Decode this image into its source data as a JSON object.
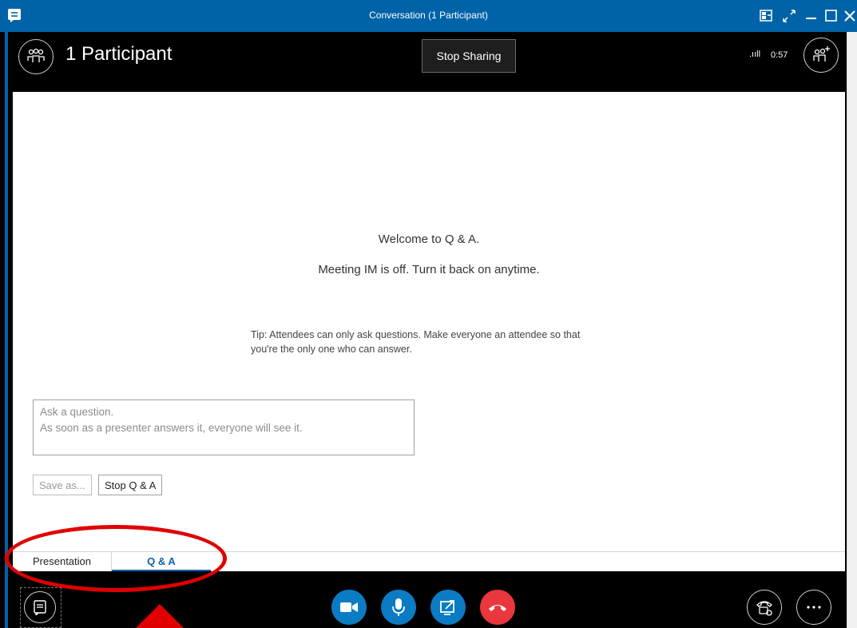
{
  "window": {
    "title": "Conversation (1 Participant)"
  },
  "header": {
    "participants_label": "1 Participant",
    "stop_sharing_label": "Stop Sharing",
    "signal_label": ".ııll",
    "timer": "0:57"
  },
  "qa": {
    "welcome": "Welcome to Q & A.",
    "im_status": "Meeting IM is off. Turn it back on anytime.",
    "tip_line1": "Tip: Attendees can only ask questions. Make everyone an attendee so that",
    "tip_line2": "you're the only one who can answer.",
    "question_placeholder_line1": "Ask a question.",
    "question_placeholder_line2": "As soon as a presenter answers it, everyone will see it.",
    "save_as_label": "Save as...",
    "stop_qa_label": "Stop Q & A"
  },
  "tabs": [
    {
      "label": "Presentation",
      "active": false
    },
    {
      "label": "Q & A",
      "active": true
    }
  ],
  "colors": {
    "title_bar": "#0063a8",
    "accent": "#0a62b0",
    "video_button": "#0b7bc4",
    "hangup_button": "#e8383d",
    "annotation": "#e00000"
  },
  "icons": {
    "app": "chat-bubble-icon",
    "participants": "people-icon",
    "add_people": "add-people-icon",
    "video": "video-camera-icon",
    "mic": "microphone-icon",
    "share": "share-screen-icon",
    "hangup": "hang-up-icon",
    "devices": "phone-settings-icon",
    "more": "more-options-icon",
    "im": "instant-message-icon"
  }
}
